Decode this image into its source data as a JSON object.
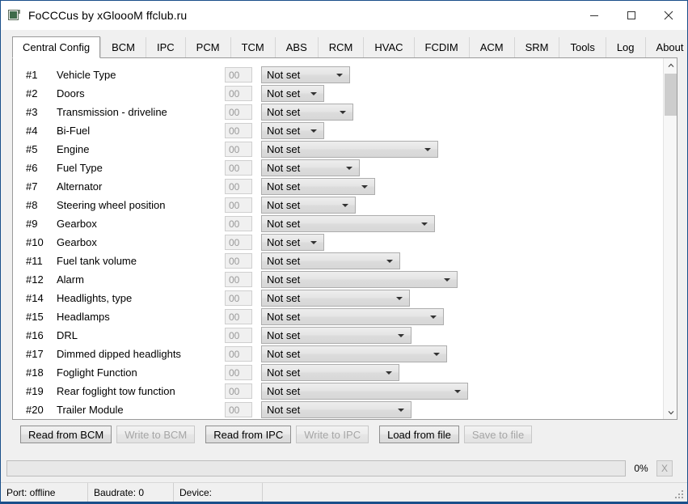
{
  "window": {
    "title": "FoCCCus by xGloooM ffclub.ru",
    "icon": "app-icon",
    "controls": [
      {
        "name": "minimize",
        "glyph": "minimize-icon"
      },
      {
        "name": "maximize",
        "glyph": "maximize-icon"
      },
      {
        "name": "close",
        "glyph": "close-icon"
      }
    ]
  },
  "tabs": [
    {
      "label": "Central Config",
      "active": true
    },
    {
      "label": "BCM",
      "active": false
    },
    {
      "label": "IPC",
      "active": false
    },
    {
      "label": "PCM",
      "active": false
    },
    {
      "label": "TCM",
      "active": false
    },
    {
      "label": "ABS",
      "active": false
    },
    {
      "label": "RCM",
      "active": false
    },
    {
      "label": "HVAC",
      "active": false
    },
    {
      "label": "FCDIM",
      "active": false
    },
    {
      "label": "ACM",
      "active": false
    },
    {
      "label": "SRM",
      "active": false
    },
    {
      "label": "Tools",
      "active": false
    },
    {
      "label": "Log",
      "active": false
    },
    {
      "label": "About",
      "active": false
    }
  ],
  "config_rows": [
    {
      "index": "#1",
      "label": "Vehicle Type",
      "value": "00",
      "selected": "Not set",
      "combo_width": 110
    },
    {
      "index": "#2",
      "label": "Doors",
      "value": "00",
      "selected": "Not set",
      "combo_width": 78
    },
    {
      "index": "#3",
      "label": "Transmission - driveline",
      "value": "00",
      "selected": "Not set",
      "combo_width": 114
    },
    {
      "index": "#4",
      "label": "Bi-Fuel",
      "value": "00",
      "selected": "Not set",
      "combo_width": 78
    },
    {
      "index": "#5",
      "label": "Engine",
      "value": "00",
      "selected": "Not set",
      "combo_width": 219
    },
    {
      "index": "#6",
      "label": "Fuel Type",
      "value": "00",
      "selected": "Not set",
      "combo_width": 122
    },
    {
      "index": "#7",
      "label": "Alternator",
      "value": "00",
      "selected": "Not set",
      "combo_width": 141
    },
    {
      "index": "#8",
      "label": "Steering wheel position",
      "value": "00",
      "selected": "Not set",
      "combo_width": 117
    },
    {
      "index": "#9",
      "label": "Gearbox",
      "value": "00",
      "selected": "Not set",
      "combo_width": 215
    },
    {
      "index": "#10",
      "label": "Gearbox",
      "value": "00",
      "selected": "Not set",
      "combo_width": 78
    },
    {
      "index": "#11",
      "label": "Fuel tank volume",
      "value": "00",
      "selected": "Not set",
      "combo_width": 172
    },
    {
      "index": "#12",
      "label": "Alarm",
      "value": "00",
      "selected": "Not set",
      "combo_width": 243
    },
    {
      "index": "#14",
      "label": "Headlights, type",
      "value": "00",
      "selected": "Not set",
      "combo_width": 184
    },
    {
      "index": "#15",
      "label": "Headlamps",
      "value": "00",
      "selected": "Not set",
      "combo_width": 226
    },
    {
      "index": "#16",
      "label": "DRL",
      "value": "00",
      "selected": "Not set",
      "combo_width": 186
    },
    {
      "index": "#17",
      "label": "Dimmed dipped headlights",
      "value": "00",
      "selected": "Not set",
      "combo_width": 230
    },
    {
      "index": "#18",
      "label": "Foglight Function",
      "value": "00",
      "selected": "Not set",
      "combo_width": 171
    },
    {
      "index": "#19",
      "label": "Rear foglight tow function",
      "value": "00",
      "selected": "Not set",
      "combo_width": 256
    },
    {
      "index": "#20",
      "label": "Trailer Module",
      "value": "00",
      "selected": "Not set",
      "combo_width": 186
    }
  ],
  "actions": [
    {
      "label": "Read from BCM",
      "disabled": false
    },
    {
      "label": "Write to BCM",
      "disabled": true
    },
    {
      "label": "Read from IPC",
      "disabled": false
    },
    {
      "label": "Write to IPC",
      "disabled": true
    },
    {
      "label": "Load from file",
      "disabled": false
    },
    {
      "label": "Save to file",
      "disabled": true
    }
  ],
  "progress": {
    "percent_label": "0%",
    "percent_value": 0,
    "cancel_label": "X"
  },
  "status": {
    "port": "Port: offline",
    "baudrate": "Baudrate: 0",
    "device": "Device:"
  }
}
